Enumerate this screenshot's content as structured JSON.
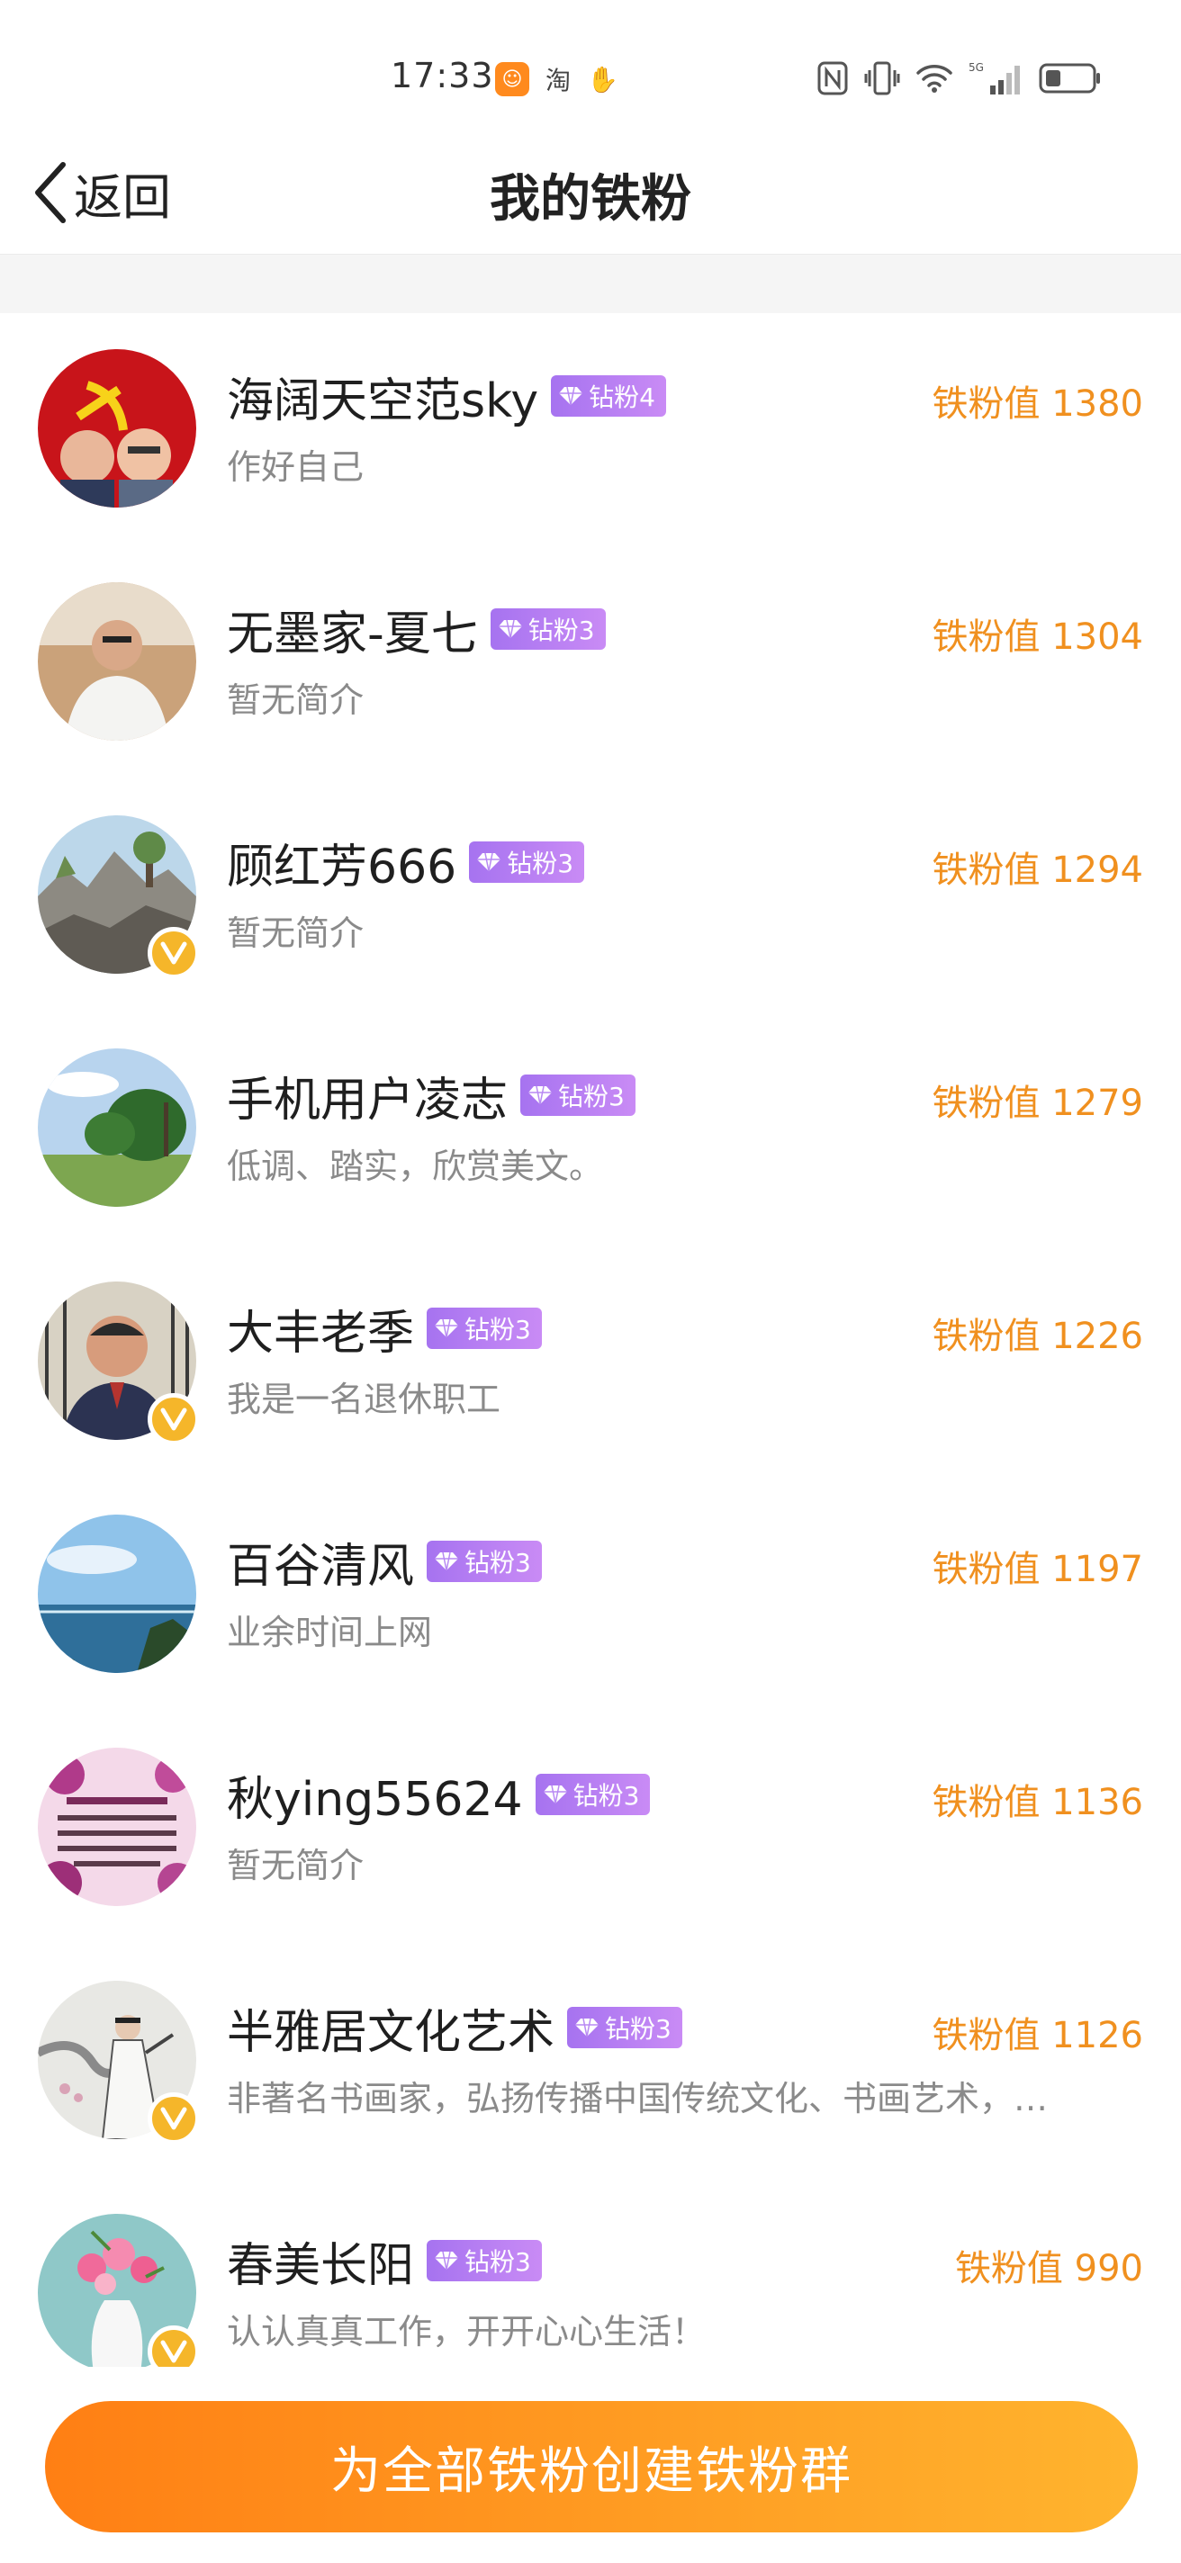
{
  "status_bar": {
    "time": "17:33",
    "app_badge_glyph": "☺",
    "taobao_glyph": "淘",
    "gesture_glyph": "✋",
    "network": "5G"
  },
  "header": {
    "back_label": "返回",
    "title": "我的铁粉"
  },
  "fans": [
    {
      "name": "海阔天空范sky",
      "level": "钻粉4",
      "bio": "作好自己",
      "score": "铁粉值 1380",
      "verified": false,
      "avatar": "party-flag-couple"
    },
    {
      "name": "无墨家-夏七",
      "level": "钻粉3",
      "bio": "暂无简介",
      "score": "铁粉值 1304",
      "verified": false,
      "avatar": "man-white-shirt"
    },
    {
      "name": "顾红芳666",
      "level": "钻粉3",
      "bio": "暂无简介",
      "score": "铁粉值 1294",
      "verified": true,
      "avatar": "rock-garden"
    },
    {
      "name": "手机用户凌志",
      "level": "钻粉3",
      "bio": "低调、踏实，欣赏美文。",
      "score": "铁粉值 1279",
      "verified": false,
      "avatar": "tropical-trees"
    },
    {
      "name": "大丰老季",
      "level": "钻粉3",
      "bio": "我是一名退休职工",
      "score": "铁粉值 1226",
      "verified": true,
      "avatar": "man-portrait"
    },
    {
      "name": "百谷清风",
      "level": "钻粉3",
      "bio": "业余时间上网",
      "score": "铁粉值 1197",
      "verified": false,
      "avatar": "seascape"
    },
    {
      "name": "秋ying55624",
      "level": "钻粉3",
      "bio": "暂无简介",
      "score": "铁粉值 1136",
      "verified": false,
      "avatar": "floral-quote-card"
    },
    {
      "name": "半雅居文化艺术",
      "level": "钻粉3",
      "bio": "非著名书画家，弘扬传播中国传统文化、书画艺术，…",
      "score": "铁粉值 1126",
      "verified": true,
      "avatar": "ink-painting-scholar"
    },
    {
      "name": "春美长阳",
      "level": "钻粉3",
      "bio": "认认真真工作，开开心心生活！",
      "score": "铁粉值 990",
      "verified": true,
      "avatar": "flower-vase"
    }
  ],
  "footer": {
    "button_label": "为全部铁粉创建铁粉群"
  },
  "colors": {
    "accent_orange": "#f0901f",
    "level_purple": "#b07cf2",
    "verified_gold": "#f5b62a"
  }
}
